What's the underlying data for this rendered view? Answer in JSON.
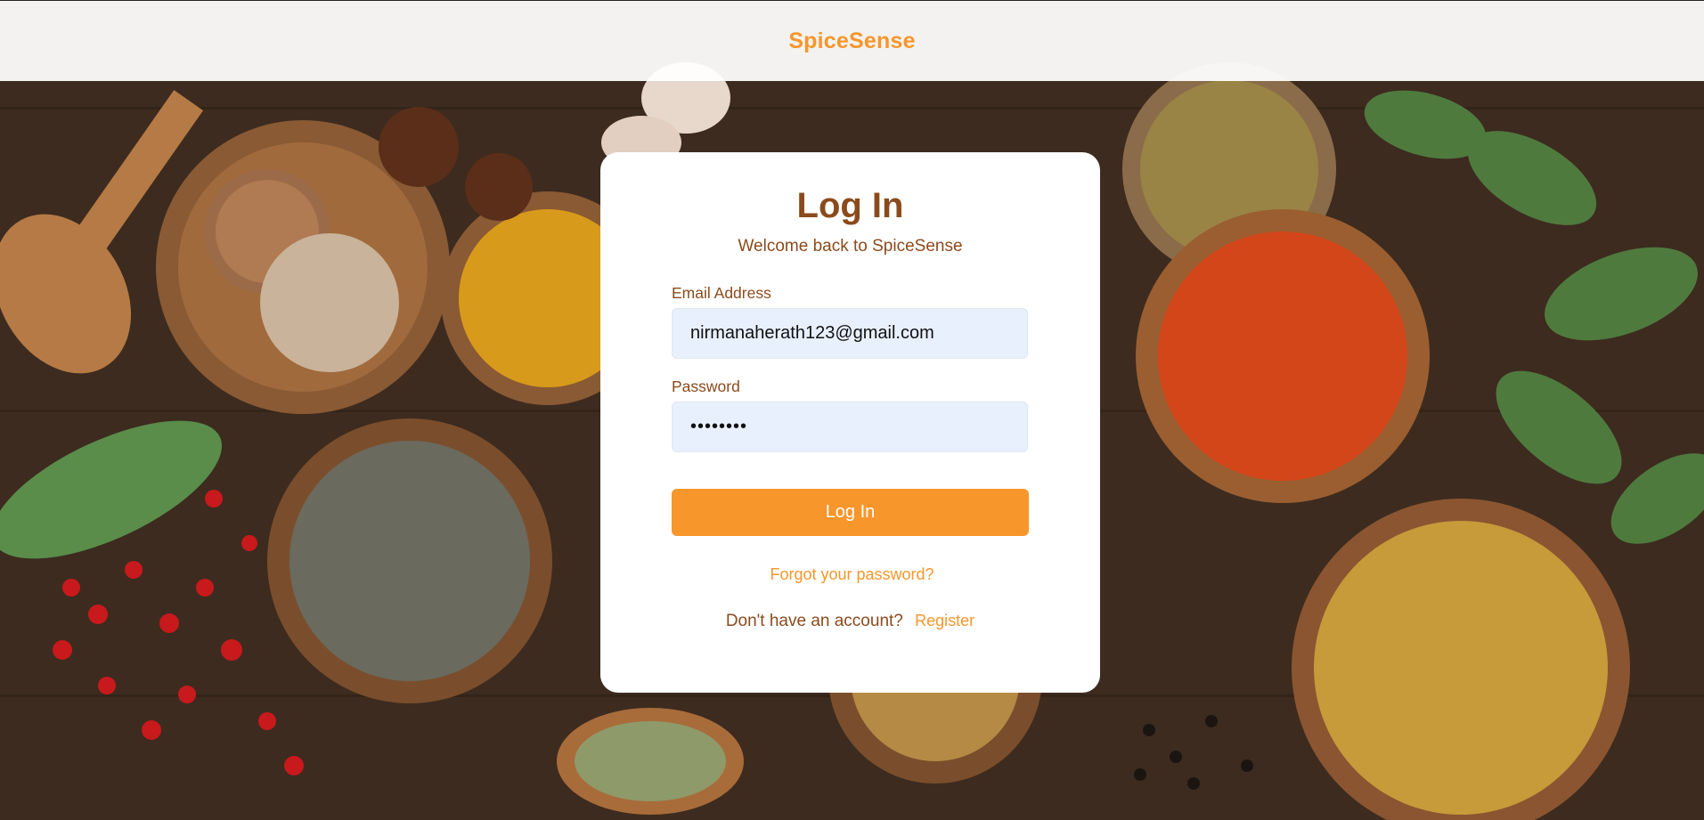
{
  "header": {
    "brand": "SpiceSense"
  },
  "login": {
    "title": "Log In",
    "subtitle": "Welcome back to SpiceSense",
    "email_label": "Email Address",
    "email_value": "nirmanaherath123@gmail.com",
    "password_label": "Password",
    "password_value": "password",
    "submit_label": "Log In",
    "forgot_label": "Forgot your password?",
    "no_account_text": "Don't have an account?",
    "register_label": "Register"
  },
  "colors": {
    "accent": "#f7962b",
    "heading": "#8b4a1c",
    "input_bg": "#e8f0fe"
  }
}
